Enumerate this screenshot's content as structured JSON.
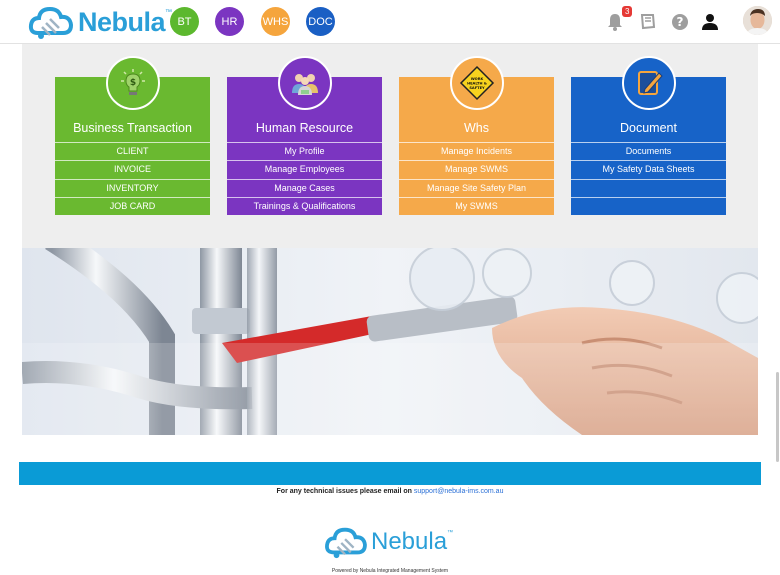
{
  "brand": {
    "name": "Nebula",
    "tm": "™"
  },
  "modules": [
    {
      "label": "BT",
      "color": "#5cb82e"
    },
    {
      "label": "HR",
      "color": "#7b35c1"
    },
    {
      "label": "WHS",
      "color": "#f5a53d"
    },
    {
      "label": "DOC",
      "color": "#1a5fc4"
    }
  ],
  "notifications": {
    "count": "3"
  },
  "icons": [
    "bell-icon",
    "book-icon",
    "help-icon",
    "user-icon"
  ],
  "cards": [
    {
      "title": "Business Transaction",
      "color": "#6ab930",
      "icon": "dollar-bulb-icon",
      "items": [
        "CLIENT",
        "INVOICE",
        "INVENTORY",
        "JOB CARD"
      ]
    },
    {
      "title": "Human Resource",
      "color": "#7b35c1",
      "icon": "people-icon",
      "items": [
        "My Profile",
        "Manage Employees",
        "Manage Cases",
        "Trainings & Qualifications"
      ]
    },
    {
      "title": "Whs",
      "color": "#f5a94a",
      "icon": "whs-sign-icon",
      "sign_text": "WORK HEALTH & SAFTEY",
      "items": [
        "Manage Incidents",
        "Manage SWMS",
        "Manage Site Safety Plan",
        "My SWMS"
      ]
    },
    {
      "title": "Document",
      "color": "#1763c8",
      "icon": "document-pen-icon",
      "items": [
        "Documents",
        "My Safety Data Sheets",
        "",
        ""
      ]
    }
  ],
  "footer": {
    "support_text": "For any technical issues please email on",
    "support_email": "support@nebula-ims.com.au",
    "powered_by": "Powered by Nebula Integrated Management System"
  }
}
